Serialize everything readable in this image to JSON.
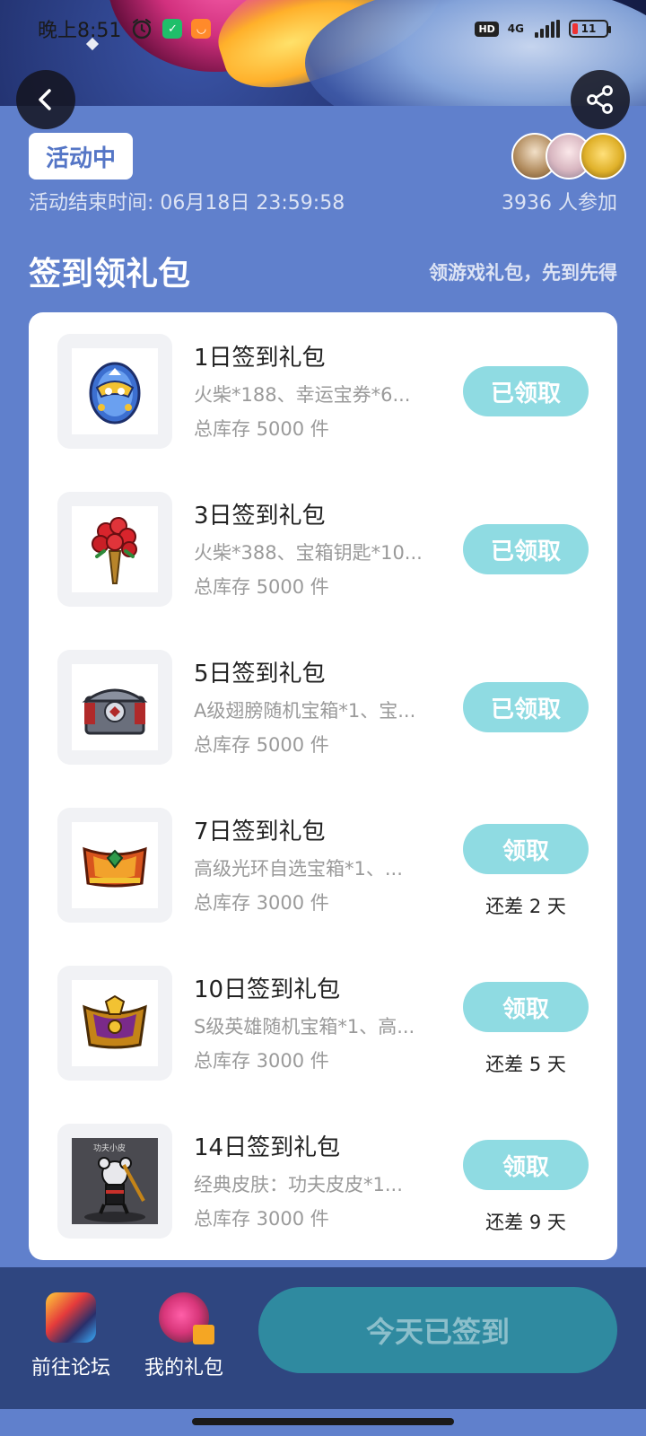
{
  "status_bar": {
    "time": "晚上8:51",
    "network": "4G",
    "hd": "HD",
    "battery": "11"
  },
  "header": {
    "status_label": "活动中",
    "end_time": "活动结束时间: 06月18日 23:59:58",
    "participants": "3936 人参加"
  },
  "section": {
    "title": "签到领礼包",
    "subtitle": "领游戏礼包，先到先得"
  },
  "gifts": [
    {
      "name": "1日签到礼包",
      "desc": "火柴*188、幸运宝券*6...",
      "stock": "总库存 5000 件",
      "button": "已领取",
      "remain": "",
      "icon": "lucky-egg-icon"
    },
    {
      "name": "3日签到礼包",
      "desc": "火柴*388、宝箱钥匙*10...",
      "stock": "总库存 5000 件",
      "button": "已领取",
      "remain": "",
      "icon": "flower-torch-icon"
    },
    {
      "name": "5日签到礼包",
      "desc": "A级翅膀随机宝箱*1、宝...",
      "stock": "总库存 5000 件",
      "button": "已领取",
      "remain": "",
      "icon": "treasure-chest-icon"
    },
    {
      "name": "7日签到礼包",
      "desc": "高级光环自选宝箱*1、...",
      "stock": "总库存 3000 件",
      "button": "领取",
      "remain": "还差 2 天",
      "icon": "halo-chest-icon"
    },
    {
      "name": "10日签到礼包",
      "desc": "S级英雄随机宝箱*1、高...",
      "stock": "总库存 3000 件",
      "button": "领取",
      "remain": "还差 5 天",
      "icon": "hero-chest-icon"
    },
    {
      "name": "14日签到礼包",
      "desc": "经典皮肤：功夫皮皮*1...",
      "stock": "总库存 3000 件",
      "button": "领取",
      "remain": "还差 9 天",
      "icon": "kungfu-skin-icon",
      "thumb_caption": "功夫小皮"
    }
  ],
  "bottom_bar": {
    "forum_label": "前往论坛",
    "mygift_label": "我的礼包",
    "checkin_label": "今天已签到"
  },
  "colors": {
    "page_bg": "#6080cc",
    "accent_button": "#8fdbe2",
    "bottom_bar": "#2f4680",
    "checkin_button": "#2f8aa0"
  }
}
